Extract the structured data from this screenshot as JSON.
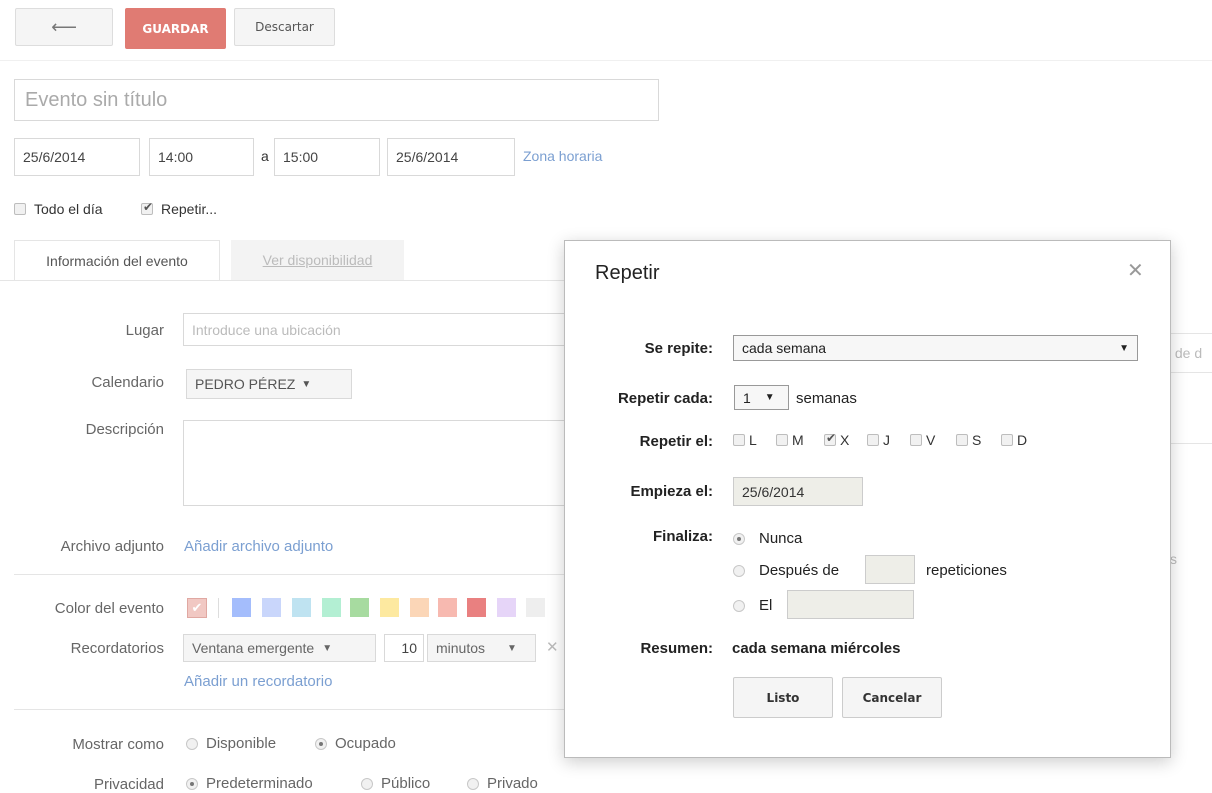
{
  "toolbar": {
    "back_icon": "arrow-left-icon",
    "save_label": "GUARDAR",
    "discard_label": "Descartar",
    "save_color": "#e07b73"
  },
  "event": {
    "title_placeholder": "Evento sin título",
    "start_date": "25/6/2014",
    "start_time": "14:00",
    "to_label": "a",
    "end_time": "15:00",
    "end_date": "25/6/2014",
    "timezone_link": "Zona horaria",
    "all_day_label": "Todo el día",
    "repeat_label": "Repetir..."
  },
  "tabs": {
    "info": "Información del evento",
    "availability": "Ver disponibilidad"
  },
  "form": {
    "location_label": "Lugar",
    "location_placeholder": "Introduce una ubicación",
    "calendar_label": "Calendario",
    "calendar_value": "PEDRO PÉREZ",
    "description_label": "Descripción",
    "attachment_label": "Archivo adjunto",
    "attachment_link": "Añadir archivo adjunto",
    "color_label": "Color del evento",
    "colors": [
      "#a4bdfc",
      "#c9d6fb",
      "#bfe3f1",
      "#b3efd3",
      "#a7dba0",
      "#fde9a0",
      "#fbd6b7",
      "#f7b9b0",
      "#e98080",
      "#e6d5f8",
      "#eeeeee"
    ],
    "reminders_label": "Recordatorios",
    "reminder_type": "Ventana emergente",
    "reminder_value": "10",
    "reminder_unit": "minutos",
    "add_reminder_link": "Añadir un recordatorio",
    "show_as_label": "Mostrar como",
    "show_available": "Disponible",
    "show_busy": "Ocupado",
    "privacy_label": "Privacidad",
    "privacy_default": "Predeterminado",
    "privacy_public": "Público",
    "privacy_private": "Privado",
    "right_fragment": "s de d",
    "right_fragment_s": "s"
  },
  "dialog": {
    "title": "Repetir",
    "close_icon": "close-icon",
    "repeats_label": "Se repite:",
    "repeats_value": "cada semana",
    "every_label": "Repetir cada:",
    "every_value": "1",
    "every_unit": "semanas",
    "on_label": "Repetir el:",
    "days": [
      {
        "label": "L",
        "checked": false
      },
      {
        "label": "M",
        "checked": false
      },
      {
        "label": "X",
        "checked": true
      },
      {
        "label": "J",
        "checked": false
      },
      {
        "label": "V",
        "checked": false
      },
      {
        "label": "S",
        "checked": false
      },
      {
        "label": "D",
        "checked": false
      }
    ],
    "starts_label": "Empieza el:",
    "starts_value": "25/6/2014",
    "ends_label": "Finaliza:",
    "ends_never": "Nunca",
    "ends_after": "Después de",
    "ends_after_unit": "repeticiones",
    "ends_on": "El",
    "summary_label": "Resumen:",
    "summary_value": "cada semana miércoles",
    "done_label": "Listo",
    "cancel_label": "Cancelar"
  }
}
